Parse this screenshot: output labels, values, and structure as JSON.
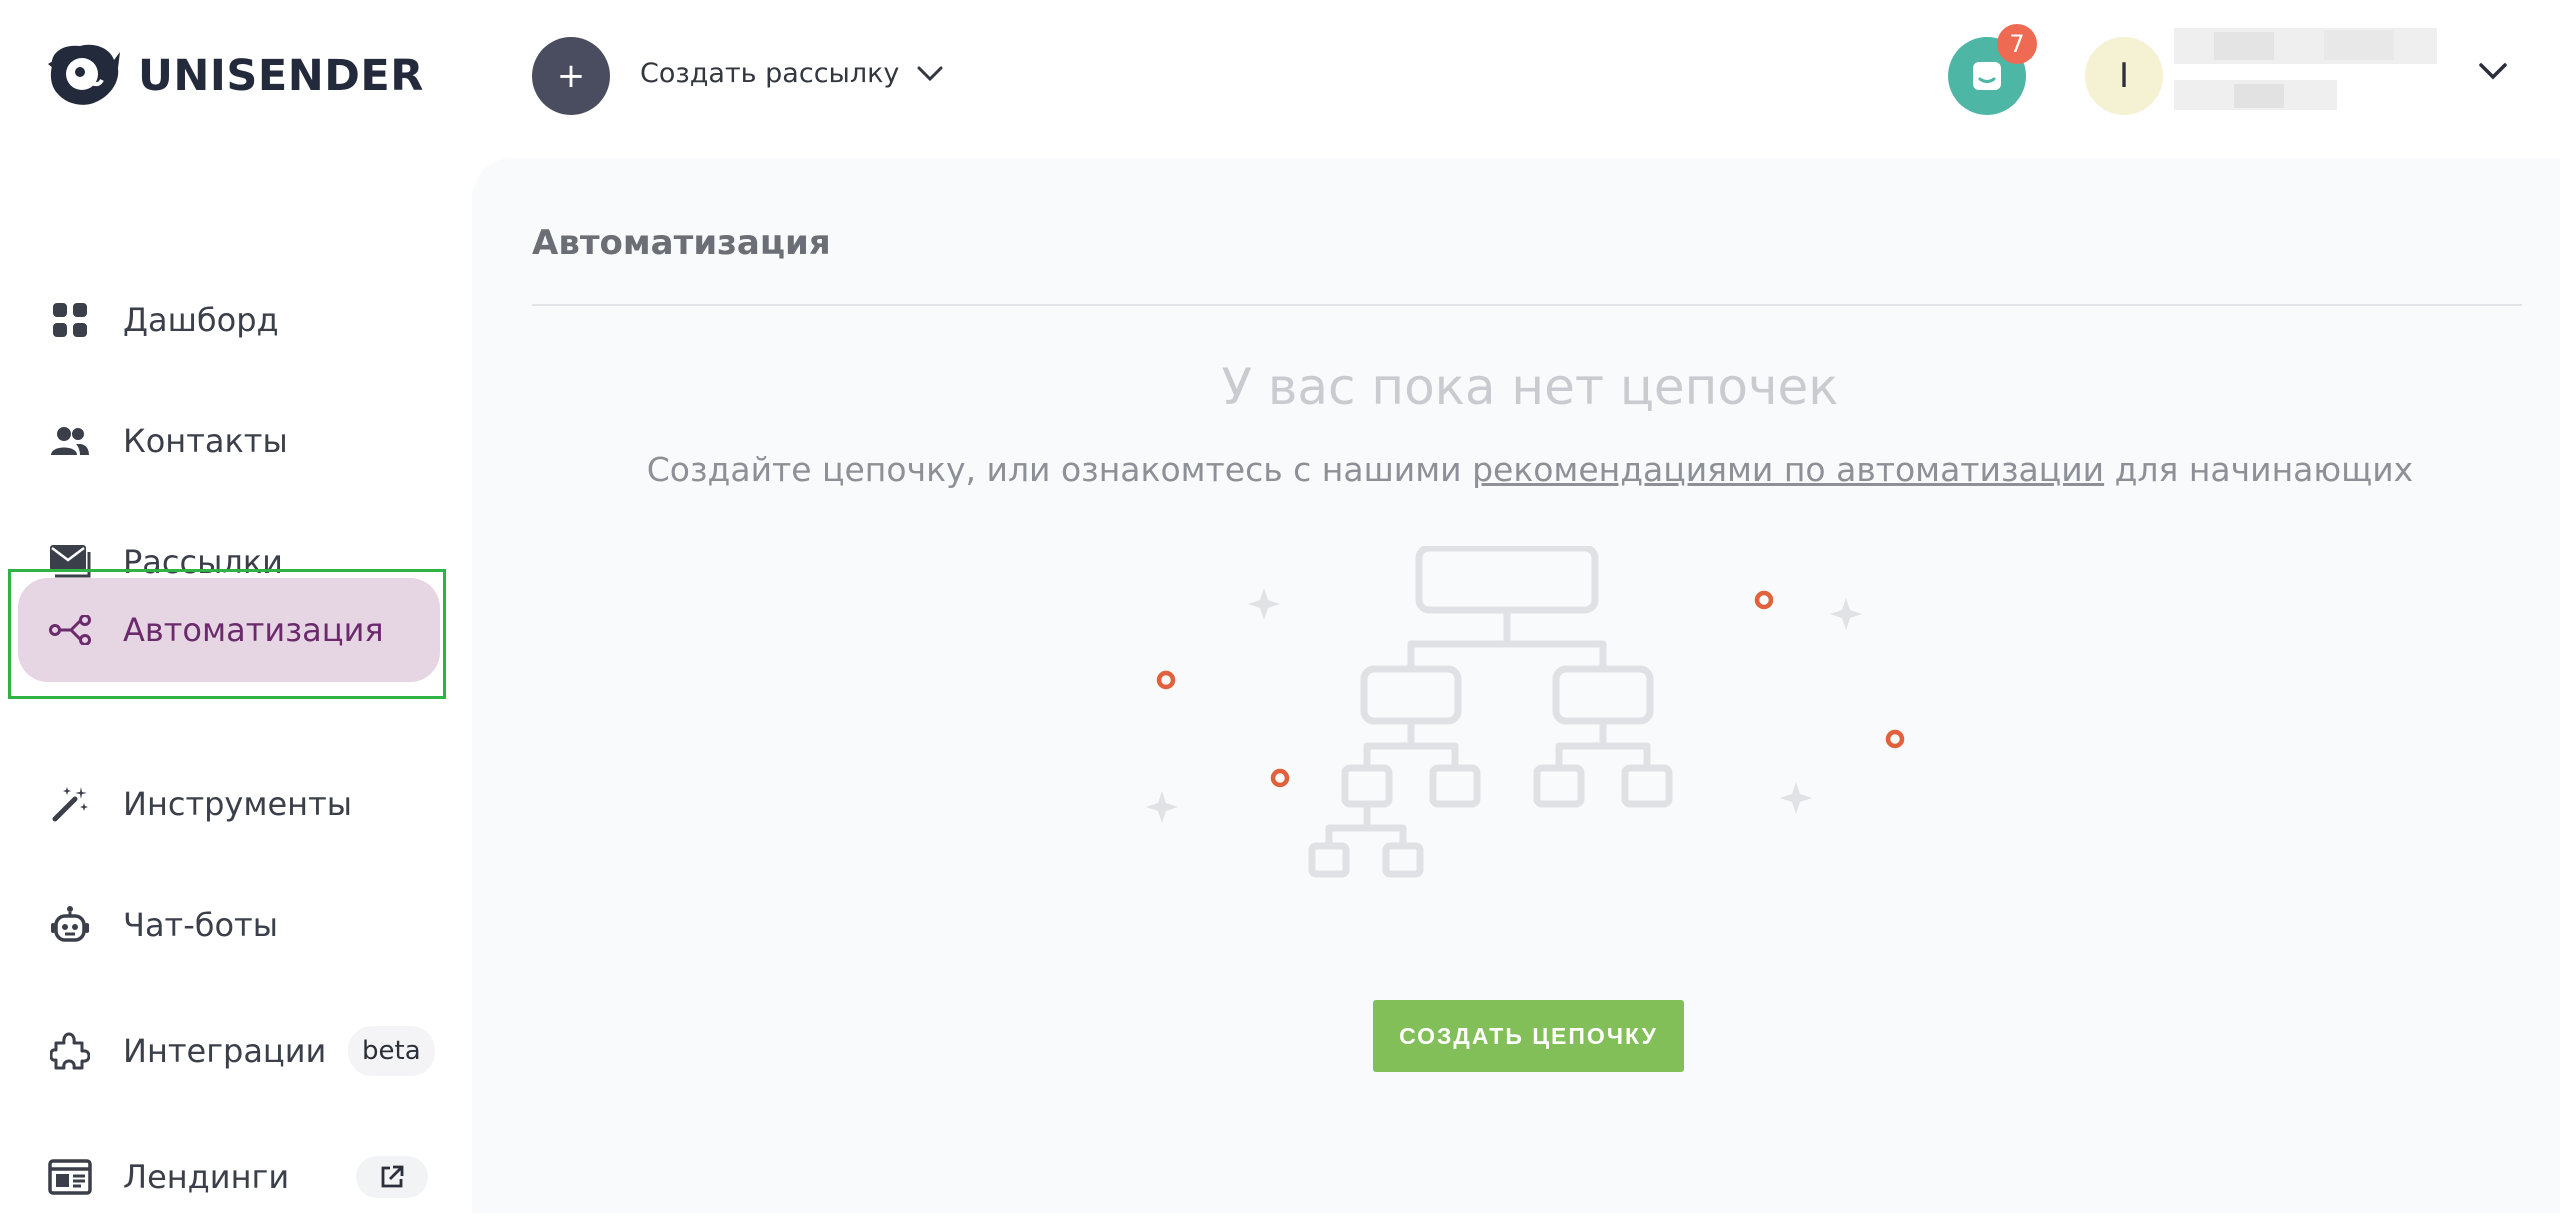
{
  "app": {
    "brand": "UNISENDER"
  },
  "header": {
    "create_button_symbol": "+",
    "create_label": "Создать рассылку",
    "chat_badge_count": "7",
    "avatar_initial": "I"
  },
  "sidebar": {
    "items": [
      {
        "label": "Дашборд",
        "icon": "dashboard-icon"
      },
      {
        "label": "Контакты",
        "icon": "contacts-icon"
      },
      {
        "label": "Рассылки",
        "icon": "mailings-icon"
      },
      {
        "label": "Автоматизация",
        "icon": "automation-icon",
        "active": true
      },
      {
        "label": "Инструменты",
        "icon": "magic-wand-icon"
      },
      {
        "label": "Чат-боты",
        "icon": "robot-icon"
      },
      {
        "label": "Интеграции",
        "icon": "puzzle-icon",
        "tag": "beta"
      },
      {
        "label": "Лендинги",
        "icon": "landing-icon",
        "external_icon": "external-link-icon"
      }
    ]
  },
  "main": {
    "page_title": "Автоматизация",
    "empty_title": "У вас пока нет цепочек",
    "empty_sub_before": "Создайте цепочку, или ознакомтесь с нашими ",
    "empty_sub_link": "рекомендациями по автоматизации",
    "empty_sub_after": " для начинающих",
    "cta_label": "СОЗДАТЬ ЦЕПОЧКУ"
  },
  "colors": {
    "accent_active_bg": "#e6d5e3",
    "accent_active_text": "#6b2a6c",
    "cta": "#82bf59",
    "chat": "#4db6a5",
    "badge": "#ee6a52",
    "dot": "#e0613b"
  }
}
